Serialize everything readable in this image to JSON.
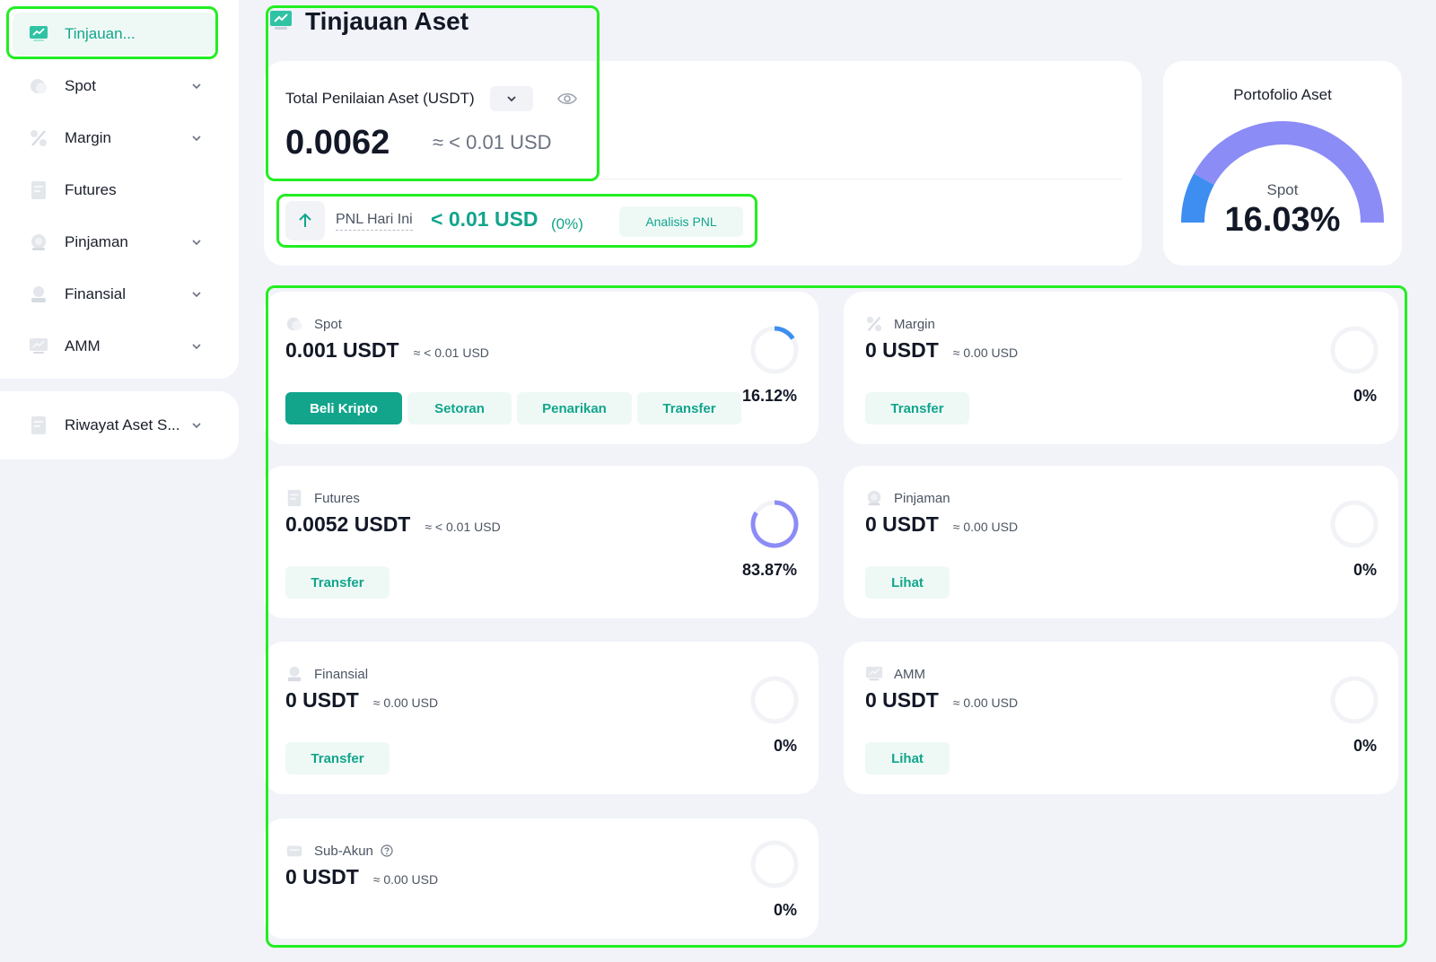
{
  "sidebar": {
    "items": [
      {
        "label": "Tinjauan...",
        "icon": "chart-icon"
      },
      {
        "label": "Spot",
        "icon": "coin-icon"
      },
      {
        "label": "Margin",
        "icon": "percent-icon"
      },
      {
        "label": "Futures",
        "icon": "document-icon"
      },
      {
        "label": "Pinjaman",
        "icon": "loan-icon"
      },
      {
        "label": "Finansial",
        "icon": "finance-icon"
      },
      {
        "label": "AMM",
        "icon": "monitor-icon"
      }
    ],
    "history": {
      "label": "Riwayat Aset S...",
      "icon": "history-icon"
    }
  },
  "header": {
    "title": "Tinjauan Aset"
  },
  "total": {
    "label": "Total Penilaian Aset (USDT)",
    "value": "0.0062",
    "approx": "≈ < 0.01 USD"
  },
  "pnl": {
    "label": "PNL Hari Ini",
    "value": "< 0.01 USD",
    "pct": "(0%)",
    "button": "Analisis PNL"
  },
  "portfolio": {
    "title": "Portofolio Aset",
    "label": "Spot",
    "value": "16.03%",
    "spot_fraction": 0.1603
  },
  "assets": {
    "spot": {
      "name": "Spot",
      "value": "0.001 USDT",
      "approx": "≈ < 0.01 USD",
      "pct": "16.12%",
      "fraction": 0.1612,
      "buttons": [
        "Beli Kripto",
        "Setoran",
        "Penarikan",
        "Transfer"
      ]
    },
    "margin": {
      "name": "Margin",
      "value": "0 USDT",
      "approx": "≈ 0.00 USD",
      "pct": "0%",
      "fraction": 0,
      "buttons": [
        "Transfer"
      ]
    },
    "futures": {
      "name": "Futures",
      "value": "0.0052 USDT",
      "approx": "≈ < 0.01 USD",
      "pct": "83.87%",
      "fraction": 0.8387,
      "buttons": [
        "Transfer"
      ]
    },
    "pinjaman": {
      "name": "Pinjaman",
      "value": "0 USDT",
      "approx": "≈ 0.00 USD",
      "pct": "0%",
      "fraction": 0,
      "buttons": [
        "Lihat"
      ]
    },
    "finansial": {
      "name": "Finansial",
      "value": "0 USDT",
      "approx": "≈ 0.00 USD",
      "pct": "0%",
      "fraction": 0,
      "buttons": [
        "Transfer"
      ]
    },
    "amm": {
      "name": "AMM",
      "value": "0 USDT",
      "approx": "≈ 0.00 USD",
      "pct": "0%",
      "fraction": 0,
      "buttons": [
        "Lihat"
      ]
    },
    "subakun": {
      "name": "Sub-Akun",
      "value": "0 USDT",
      "approx": "≈ 0.00 USD",
      "pct": "0%",
      "fraction": 0
    }
  },
  "colors": {
    "accent": "#12a58c",
    "spot": "#3d8ef0",
    "futures": "#8b8cf6",
    "highlight": "#22ee22"
  }
}
